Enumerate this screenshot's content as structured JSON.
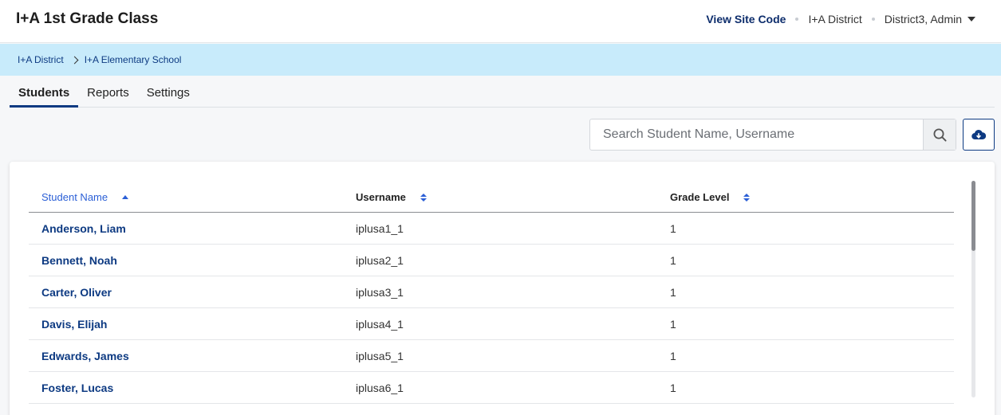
{
  "header": {
    "title": "I+A 1st Grade Class",
    "site_code_label": "View Site Code",
    "district": "I+A District",
    "user": "District3, Admin"
  },
  "breadcrumb": [
    "I+A District",
    "I+A Elementary School"
  ],
  "tabs": [
    "Students",
    "Reports",
    "Settings"
  ],
  "active_tab": "Students",
  "search": {
    "placeholder": "Search Student Name, Username",
    "value": ""
  },
  "table": {
    "columns": [
      "Student Name",
      "Username",
      "Grade Level"
    ],
    "sorted_column": "Student Name",
    "sort_direction": "ascending",
    "rows": [
      [
        "Anderson, Liam",
        "iplusa1_1",
        "1"
      ],
      [
        "Bennett, Noah",
        "iplusa2_1",
        "1"
      ],
      [
        "Carter, Oliver",
        "iplusa3_1",
        "1"
      ],
      [
        "Davis, Elijah",
        "iplusa4_1",
        "1"
      ],
      [
        "Edwards, James",
        "iplusa5_1",
        "1"
      ],
      [
        "Foster, Lucas",
        "iplusa6_1",
        "1"
      ]
    ]
  },
  "icons": {
    "search": "search-icon",
    "download": "cloud-download-icon",
    "user_menu": "caret-down-icon",
    "breadcrumb_separator": "chevron-right-icon"
  },
  "colors": {
    "brand": "#0d3a82",
    "breadcrumb_bg": "#c8ebfb",
    "sort_accent": "#2b5fd6"
  }
}
